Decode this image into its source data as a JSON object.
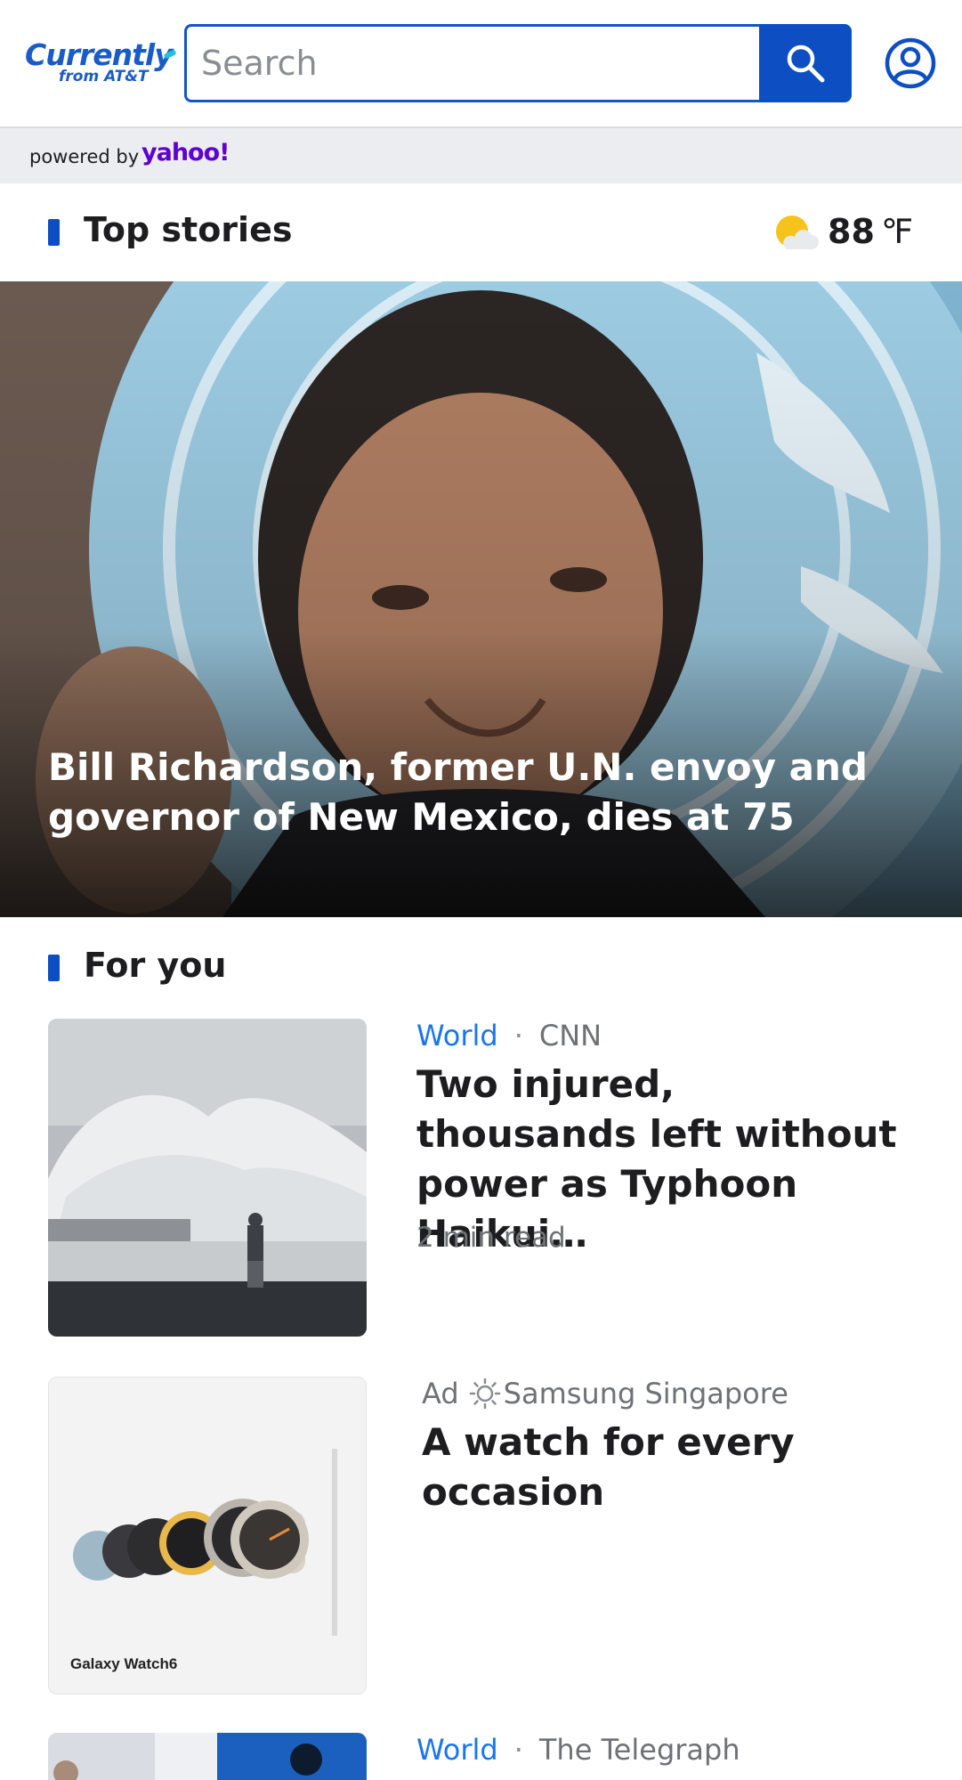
{
  "header": {
    "logo_brand": "Currently",
    "logo_sub": "from AT&T",
    "search_placeholder": "Search"
  },
  "powered": {
    "text": "powered by",
    "brand": "yahoo!"
  },
  "top_stories": {
    "title": "Top stories",
    "weather_temp": "88",
    "weather_unit": "℉",
    "hero_headline": "Bill Richardson, former U.N. envoy and governor of New Mexico, dies at 75"
  },
  "for_you": {
    "title": "For you",
    "items": [
      {
        "category": "World",
        "separator": "·",
        "source": "CNN",
        "headline": "Two injured, thousands left without power as Typhoon Haikui…",
        "read_time": "2 min read"
      },
      {
        "ad_label": "Ad",
        "advertiser": "Samsung Singapore",
        "headline": "A watch for every occasion",
        "thumb_caption": "Galaxy Watch6"
      },
      {
        "category": "World",
        "separator": "·",
        "source": "The Telegraph"
      }
    ]
  },
  "colors": {
    "accent": "#0d4fc3",
    "category": "#1976f0",
    "yahoo": "#6001d2"
  },
  "icons": {
    "search": "search-icon",
    "account": "account-icon",
    "weather": "partly-cloudy-icon",
    "ad": "sponsored-sun-icon"
  }
}
